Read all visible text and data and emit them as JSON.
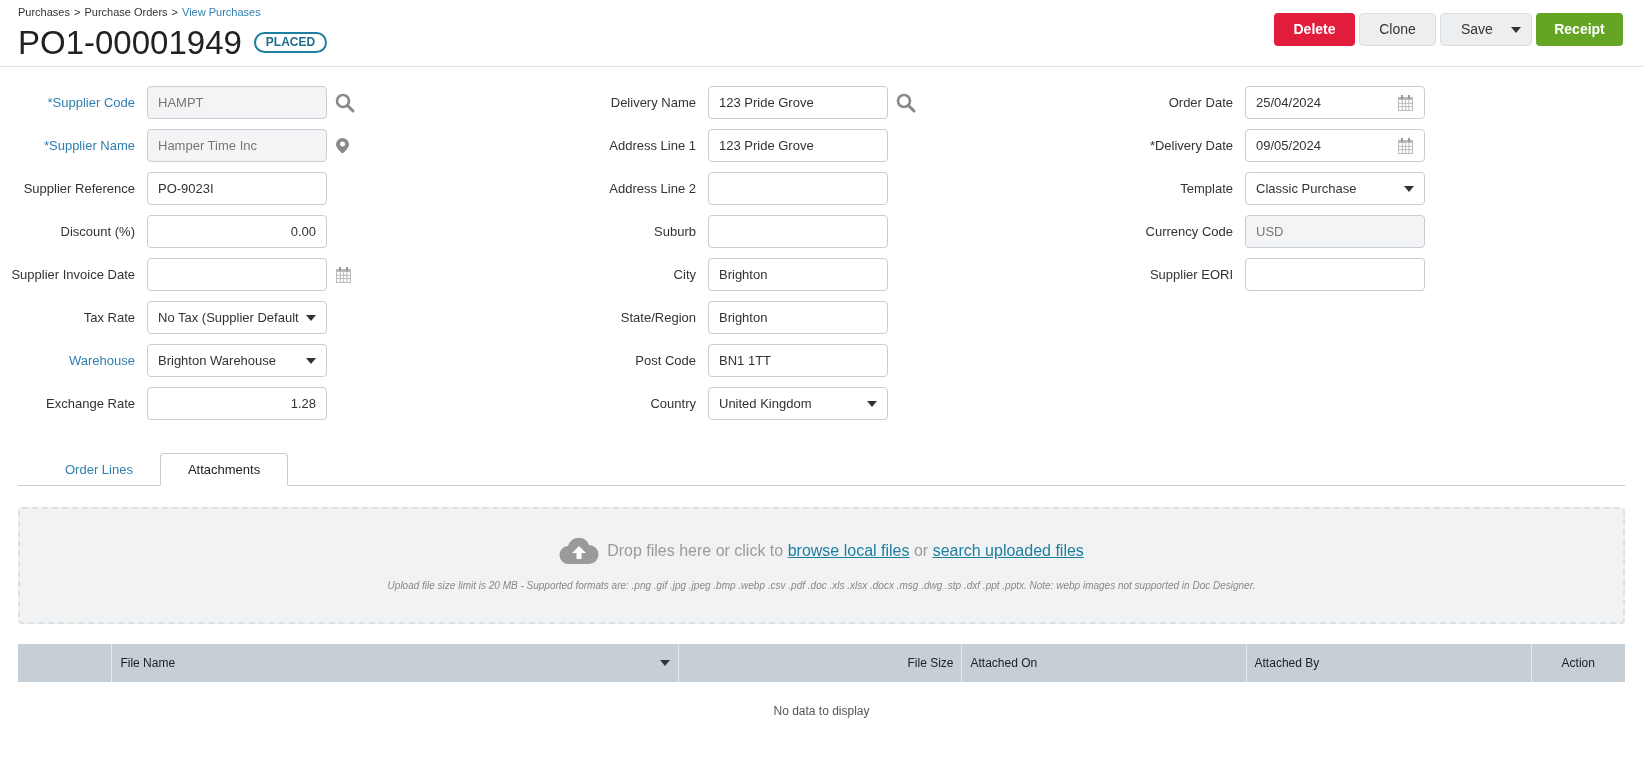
{
  "breadcrumb": [
    {
      "label": "Purchases",
      "link": false
    },
    {
      "label": "Purchase Orders",
      "link": false
    },
    {
      "label": "View Purchases",
      "link": true
    }
  ],
  "breadcrumb_separator": ">",
  "title": "PO1-00001949",
  "status": "PLACED",
  "actions": [
    {
      "label": "Delete",
      "kind": "danger"
    },
    {
      "label": "Clone",
      "kind": "plain"
    },
    {
      "label": "Save",
      "kind": "split"
    },
    {
      "label": "Receipt",
      "kind": "success"
    }
  ],
  "form_columns": [
    [
      {
        "label": "*Supplier Code",
        "linked": true,
        "kind": "readonly",
        "value": "HAMPT",
        "search": true
      },
      {
        "label": "*Supplier Name",
        "linked": true,
        "kind": "readonly",
        "value": "Hamper Time Inc",
        "locate": true
      },
      {
        "label": "Supplier Reference",
        "linked": false,
        "kind": "text",
        "value": "PO-9023I"
      },
      {
        "label": "Discount (%)",
        "linked": false,
        "kind": "number",
        "value": "0.00"
      },
      {
        "label": "Supplier Invoice Date",
        "linked": false,
        "kind": "text",
        "calendar": true
      },
      {
        "label": "Tax Rate",
        "linked": false,
        "kind": "select",
        "value": "No Tax (Supplier Default"
      },
      {
        "label": "Warehouse",
        "linked": true,
        "kind": "select",
        "value": "Brighton Warehouse"
      },
      {
        "label": "Exchange Rate",
        "linked": false,
        "kind": "number",
        "value": "1.28"
      }
    ],
    [
      {
        "label": "Delivery Name",
        "linked": false,
        "kind": "text",
        "value": "123 Pride Grove",
        "search": true
      },
      {
        "label": "Address Line 1",
        "linked": false,
        "kind": "text",
        "value": "123 Pride Grove"
      },
      {
        "label": "Address Line 2",
        "linked": false,
        "kind": "text"
      },
      {
        "label": "Suburb",
        "linked": false,
        "kind": "text"
      },
      {
        "label": "City",
        "linked": false,
        "kind": "text",
        "value": "Brighton"
      },
      {
        "label": "State/Region",
        "linked": false,
        "kind": "text",
        "value": "Brighton"
      },
      {
        "label": "Post Code",
        "linked": false,
        "kind": "text",
        "value": "BN1 1TT"
      },
      {
        "label": "Country",
        "linked": false,
        "kind": "select",
        "value": "United Kingdom"
      }
    ],
    [
      {
        "label": "Order Date",
        "linked": false,
        "kind": "date",
        "value": "25/04/2024"
      },
      {
        "label": "*Delivery Date",
        "linked": false,
        "kind": "date",
        "value": "09/05/2024"
      },
      {
        "label": "Template",
        "linked": false,
        "kind": "select",
        "value": "Classic Purchase"
      },
      {
        "label": "Currency Code",
        "linked": false,
        "kind": "readonly",
        "value": "USD"
      },
      {
        "label": "Supplier EORI",
        "linked": false,
        "kind": "text"
      }
    ]
  ],
  "tabs": [
    {
      "label": "Order Lines",
      "selected": false
    },
    {
      "label": "Attachments",
      "selected": true
    }
  ],
  "dropzone": {
    "text": "Drop files here or click to",
    "link_1": "browse local files",
    "joiner": "or",
    "link_2": "search uploaded files",
    "note": "Upload file size limit is 20 MB - Supported formats are: .png .gif .jpg .jpeg .bmp .webp .csv .pdf .doc .xls .xlsx .docx .msg .dwg .stp .dxf .ppt .pptx. Note: webp images not supported in Doc Designer."
  },
  "table": {
    "columns": [
      {
        "kind": "select",
        "sortable": false
      },
      {
        "label": "File Name",
        "kind": "text",
        "sortable": true
      },
      {
        "label": "File Size",
        "kind": "numeric",
        "sortable": false
      },
      {
        "label": "Attached On",
        "kind": "text",
        "sortable": false
      },
      {
        "label": "Attached By",
        "kind": "text",
        "sortable": false
      },
      {
        "label": "Action",
        "kind": "action",
        "sortable": false
      }
    ],
    "empty_text": "No data to display"
  }
}
